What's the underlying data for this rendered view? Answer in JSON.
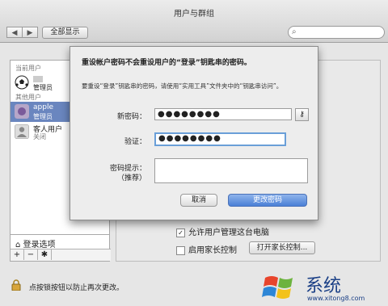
{
  "window": {
    "title": "用户与群组"
  },
  "toolbar": {
    "back": "◀",
    "forward": "▶",
    "show_all": "全部显示",
    "search_placeholder": ""
  },
  "sidebar": {
    "current_users_header": "当前用户",
    "current_user": {
      "role": "管理员"
    },
    "other_users_header": "其他用户",
    "users": [
      {
        "name": "apple",
        "role": "管理员"
      },
      {
        "name": "客人用户",
        "role": "关闭"
      }
    ],
    "login_options": "登录选项",
    "buttons": [
      "+",
      "−",
      "✱"
    ]
  },
  "main": {
    "allow_admin_label": "允许用户管理这台电脑",
    "allow_admin_checked": true,
    "parental_label": "启用家长控制",
    "parental_checked": false,
    "open_parental_button": "打开家长控制..."
  },
  "lock": {
    "text": "点按锁按钮以防止再次更改。"
  },
  "dialog": {
    "title": "重设帐户密码不会重设用户的“登录”钥匙串的密码。",
    "subtitle": "要重设“登录”钥匙串的密码，请使用“实用工具”文件夹中的“钥匙串访问”。",
    "new_password_label": "新密码：",
    "new_password_value": "●●●●●●●●",
    "verify_label": "验证：",
    "verify_value": "●●●●●●●●",
    "hint_label": "密码提示：",
    "hint_sub": "（推荐）",
    "hint_value": "",
    "cancel_button": "取消",
    "change_button": "更改密码"
  },
  "watermark": {
    "text": "系统",
    "url": "www.xitong8.com"
  }
}
